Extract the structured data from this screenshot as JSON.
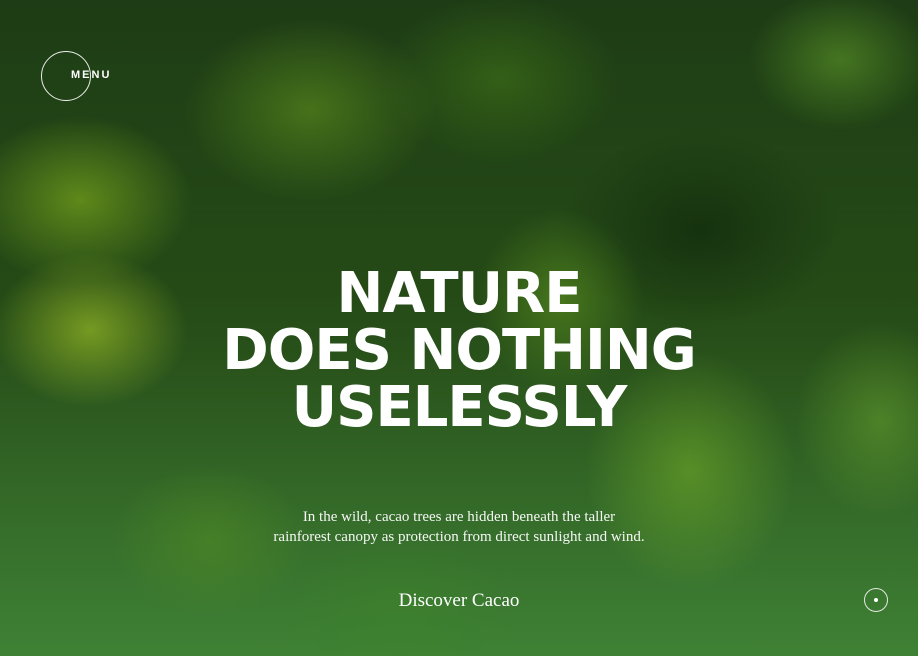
{
  "header": {
    "menu_label": "MENU"
  },
  "hero": {
    "headline_lines": [
      "NATURE",
      "DOES NOTHING",
      "USELESSLY"
    ],
    "description_lines": [
      "In the wild, cacao trees are hidden beneath the taller",
      "rainforest canopy as protection from direct sunlight and wind."
    ],
    "cta_label": "Discover Cacao"
  },
  "icons": {
    "scroll": "scroll-down-dot-icon"
  },
  "colors": {
    "text": "#ffffff",
    "forest_dark": "#1f3f16",
    "forest_light": "#3d7f32"
  }
}
